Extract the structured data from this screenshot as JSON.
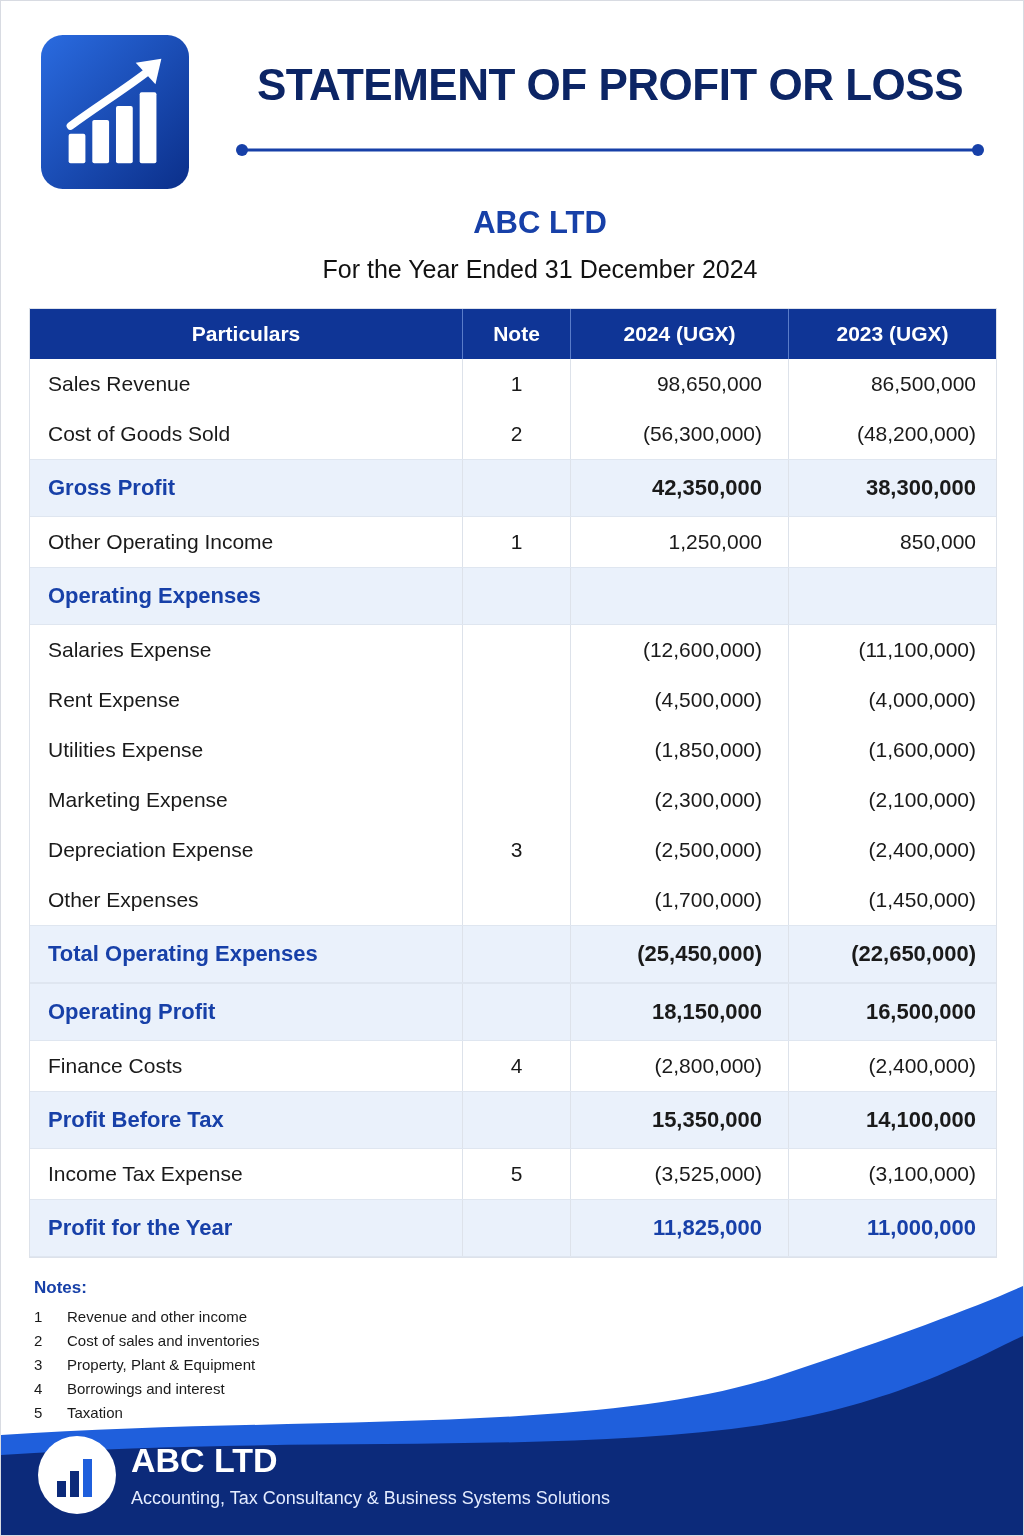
{
  "header": {
    "title": "STATEMENT OF PROFIT OR LOSS",
    "company": "ABC LTD",
    "period": "For the Year Ended 31 December 2024"
  },
  "table": {
    "columns": [
      "Particulars",
      "Note",
      "2024 (UGX)",
      "2023 (UGX)"
    ],
    "rows": [
      {
        "kind": "item",
        "label": "Sales Revenue",
        "note": "1",
        "y2024": "98,650,000",
        "y2023": "86,500,000"
      },
      {
        "kind": "item",
        "label": "Cost of Goods Sold",
        "note": "2",
        "y2024": "(56,300,000)",
        "y2023": "(48,200,000)"
      },
      {
        "kind": "subtotal",
        "label": "Gross Profit",
        "note": "",
        "y2024": "42,350,000",
        "y2023": "38,300,000"
      },
      {
        "kind": "item",
        "label": "Other Operating Income",
        "note": "1",
        "y2024": "1,250,000",
        "y2023": "850,000"
      },
      {
        "kind": "heading",
        "label": "Operating Expenses"
      },
      {
        "kind": "item",
        "label": "Salaries Expense",
        "note": "",
        "y2024": "(12,600,000)",
        "y2023": "(11,100,000)"
      },
      {
        "kind": "item",
        "label": "Rent Expense",
        "note": "",
        "y2024": "(4,500,000)",
        "y2023": "(4,000,000)"
      },
      {
        "kind": "item",
        "label": "Utilities Expense",
        "note": "",
        "y2024": "(1,850,000)",
        "y2023": "(1,600,000)"
      },
      {
        "kind": "item",
        "label": "Marketing Expense",
        "note": "",
        "y2024": "(2,300,000)",
        "y2023": "(2,100,000)"
      },
      {
        "kind": "item",
        "label": "Depreciation Expense",
        "note": "3",
        "y2024": "(2,500,000)",
        "y2023": "(2,400,000)"
      },
      {
        "kind": "item",
        "label": "Other Expenses",
        "note": "",
        "y2024": "(1,700,000)",
        "y2023": "(1,450,000)"
      },
      {
        "kind": "subtotal",
        "label": "Total Operating Expenses",
        "note": "",
        "y2024": "(25,450,000)",
        "y2023": "(22,650,000)"
      },
      {
        "kind": "subtotal",
        "label": "Operating Profit",
        "note": "",
        "y2024": "18,150,000",
        "y2023": "16,500,000"
      },
      {
        "kind": "item",
        "label": "Finance Costs",
        "note": "4",
        "y2024": "(2,800,000)",
        "y2023": "(2,400,000)"
      },
      {
        "kind": "subtotal",
        "label": "Profit Before Tax",
        "note": "",
        "y2024": "15,350,000",
        "y2023": "14,100,000"
      },
      {
        "kind": "item",
        "label": "Income Tax Expense",
        "note": "5",
        "y2024": "(3,525,000)",
        "y2023": "(3,100,000)"
      },
      {
        "kind": "total",
        "label": "Profit for the Year",
        "note": "",
        "y2024": "11,825,000",
        "y2023": "11,000,000"
      }
    ]
  },
  "notes": {
    "title": "Notes:",
    "items": [
      {
        "number": "1",
        "text": "Revenue and other income"
      },
      {
        "number": "2",
        "text": "Cost of sales and inventories"
      },
      {
        "number": "3",
        "text": "Property, Plant & Equipment"
      },
      {
        "number": "4",
        "text": "Borrowings and interest"
      },
      {
        "number": "5",
        "text": "Taxation"
      }
    ]
  },
  "footer": {
    "company": "ABC LTD",
    "tagline": "Accounting, Tax Consultancy & Business Systems Solutions"
  }
}
